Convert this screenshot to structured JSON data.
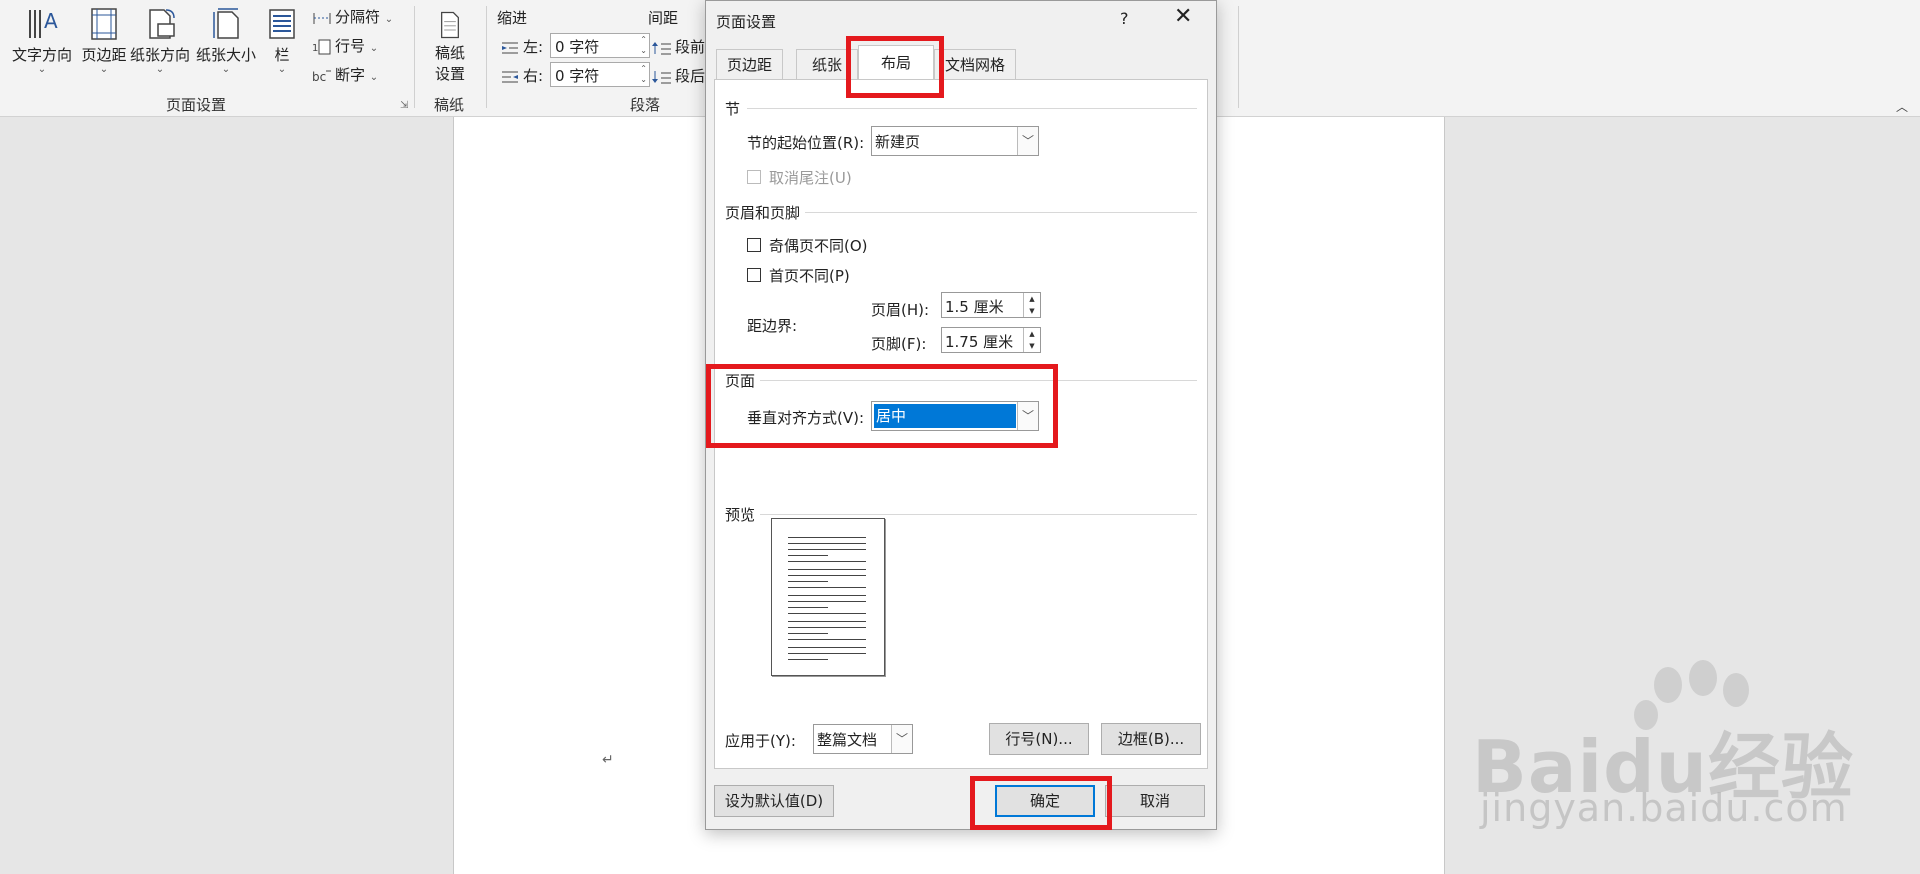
{
  "ribbon": {
    "text_direction": "文字方向",
    "margins": "页边距",
    "orientation": "纸张方向",
    "size": "纸张大小",
    "columns": "栏",
    "breaks": "分隔符",
    "line_numbers": "行号",
    "hyphenation": "断字",
    "manuscript_line1": "稿纸",
    "manuscript_line2": "设置",
    "indent_label": "缩进",
    "spacing_label": "间距",
    "indent_left_label": "左:",
    "indent_left_value": "0 字符",
    "indent_right_label": "右:",
    "indent_right_value": "0 字符",
    "before_label": "段前",
    "after_label": "段后",
    "group_page_setup": "页面设置",
    "group_manuscript": "稿纸",
    "group_paragraph": "段落"
  },
  "document": {
    "return_mark": "↵"
  },
  "watermark": {
    "text": "Baidu经验",
    "url": "jingyan.baidu.com"
  },
  "dialog": {
    "title": "页面设置",
    "help": "?",
    "close": "✕",
    "tabs": [
      "页边距",
      "纸张",
      "布局",
      "文档网格"
    ],
    "section_label": "节",
    "section_start_label": "节的起始位置(R):",
    "section_start_value": "新建页",
    "suppress_endnotes": "取消尾注(U)",
    "headers_footers_label": "页眉和页脚",
    "odd_even": "奇偶页不同(O)",
    "first_page": "首页不同(P)",
    "from_edge": "距边界:",
    "header_label": "页眉(H):",
    "header_value": "1.5 厘米",
    "footer_label": "页脚(F):",
    "footer_value": "1.75 厘米",
    "page_label": "页面",
    "valign_label": "垂直对齐方式(V):",
    "valign_value": "居中",
    "preview_label": "预览",
    "apply_to_label": "应用于(Y):",
    "apply_to_value": "整篇文档",
    "line_numbers_btn": "行号(N)...",
    "borders_btn": "边框(B)...",
    "set_default_btn": "设为默认值(D)",
    "ok_btn": "确定",
    "cancel_btn": "取消"
  },
  "colors": {
    "highlight": "#e4191d",
    "selection": "#0078d7"
  }
}
